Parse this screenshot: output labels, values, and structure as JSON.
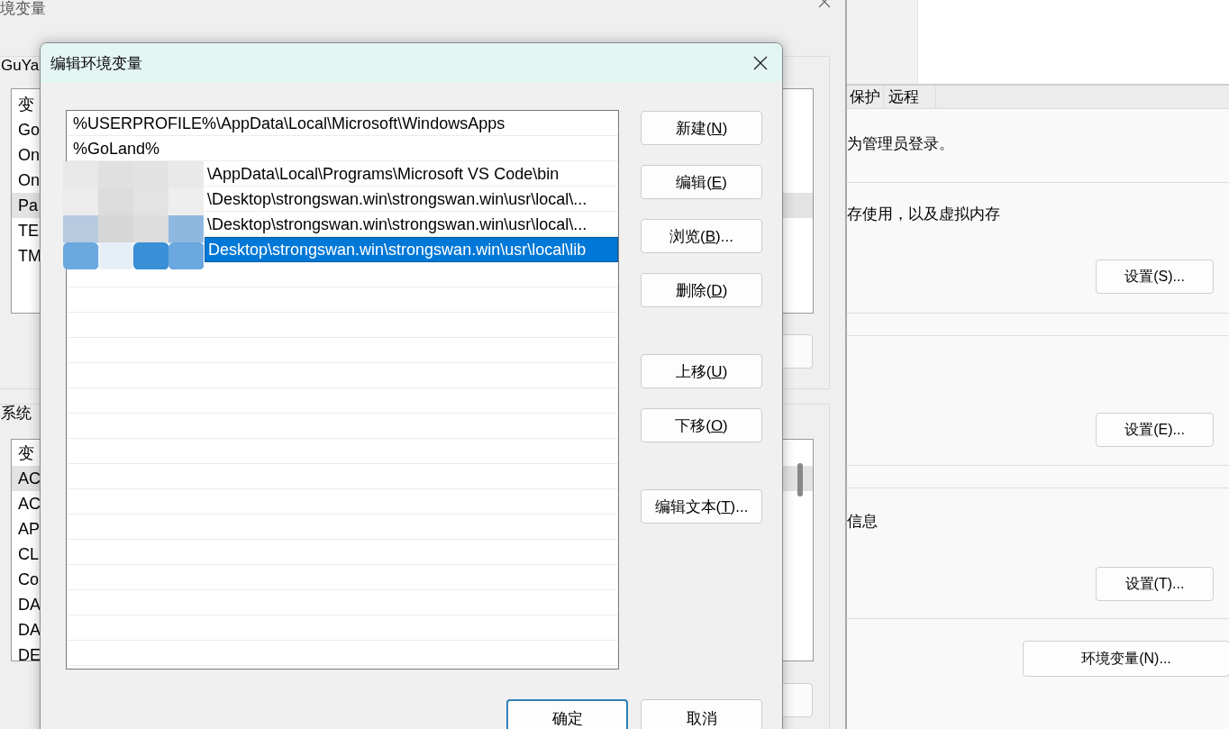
{
  "system_properties": {
    "tabs": [
      {
        "label": "保护",
        "selected": false
      },
      {
        "label": "远程",
        "selected": false
      }
    ],
    "groups": [
      {
        "items": [
          {
            "kind": "text",
            "text": "为管理员登录。"
          }
        ]
      },
      {
        "items": [
          {
            "kind": "text",
            "text": "存使用，以及虚拟内存"
          },
          {
            "kind": "button",
            "label": "设置(S)..."
          }
        ]
      },
      {
        "items": [
          {
            "kind": "button",
            "label": "设置(E)..."
          }
        ]
      },
      {
        "items": [
          {
            "kind": "text",
            "text": "信息"
          },
          {
            "kind": "button",
            "label": "设置(T)..."
          }
        ]
      },
      {
        "items": [
          {
            "kind": "button",
            "label": "环境变量(N)..."
          }
        ]
      }
    ]
  },
  "environment_variables": {
    "title": "境变量",
    "user_label": "GuYa",
    "user_list": {
      "header": "变",
      "rows": [
        {
          "text": "Go",
          "selected": false
        },
        {
          "text": "On",
          "selected": false
        },
        {
          "text": "On",
          "selected": false
        },
        {
          "text": "Pa",
          "selected": true
        },
        {
          "text": "TE",
          "selected": false
        },
        {
          "text": "TM",
          "selected": false
        }
      ]
    },
    "system_label": "系统",
    "system_list": {
      "header": "变",
      "rows": [
        {
          "text": "AC",
          "selected": true
        },
        {
          "text": "AC",
          "selected": false
        },
        {
          "text": "AP",
          "selected": false
        },
        {
          "text": "CL",
          "selected": false
        },
        {
          "text": "Co",
          "selected": false
        },
        {
          "text": "DA",
          "selected": false
        },
        {
          "text": "DA",
          "selected": false
        },
        {
          "text": "DE",
          "selected": false
        }
      ]
    }
  },
  "edit_dialog": {
    "title": "编辑环境变量",
    "entries": [
      {
        "text": "%USERPROFILE%\\AppData\\Local\\Microsoft\\WindowsApps",
        "redacted": false,
        "selected": false
      },
      {
        "text": "%GoLand%",
        "redacted": false,
        "selected": false
      },
      {
        "text": "\\AppData\\Local\\Programs\\Microsoft VS Code\\bin",
        "redacted": true,
        "selected": false
      },
      {
        "text": "\\Desktop\\strongswan.win\\strongswan.win\\usr\\local\\...",
        "redacted": true,
        "selected": false
      },
      {
        "text": "\\Desktop\\strongswan.win\\strongswan.win\\usr\\local\\...",
        "redacted": true,
        "selected": false
      },
      {
        "text": "Desktop\\strongswan.win\\strongswan.win\\usr\\local\\lib",
        "redacted": true,
        "selected": true
      }
    ],
    "button_groups": [
      [
        {
          "text": "新建(",
          "key": "N",
          "rest": ")"
        },
        {
          "text": "编辑(",
          "key": "E",
          "rest": ")"
        },
        {
          "text": "浏览(",
          "key": "B",
          "rest": ")..."
        },
        {
          "text": "删除(",
          "key": "D",
          "rest": ")"
        }
      ],
      [
        {
          "text": "上移(",
          "key": "U",
          "rest": ")"
        },
        {
          "text": "下移(",
          "key": "O",
          "rest": ")"
        }
      ],
      [
        {
          "text": "编辑文本(",
          "key": "T",
          "rest": ")..."
        }
      ]
    ],
    "footer_buttons": [
      {
        "label": "确定",
        "default": true
      },
      {
        "label": "取消",
        "default": false
      }
    ]
  }
}
